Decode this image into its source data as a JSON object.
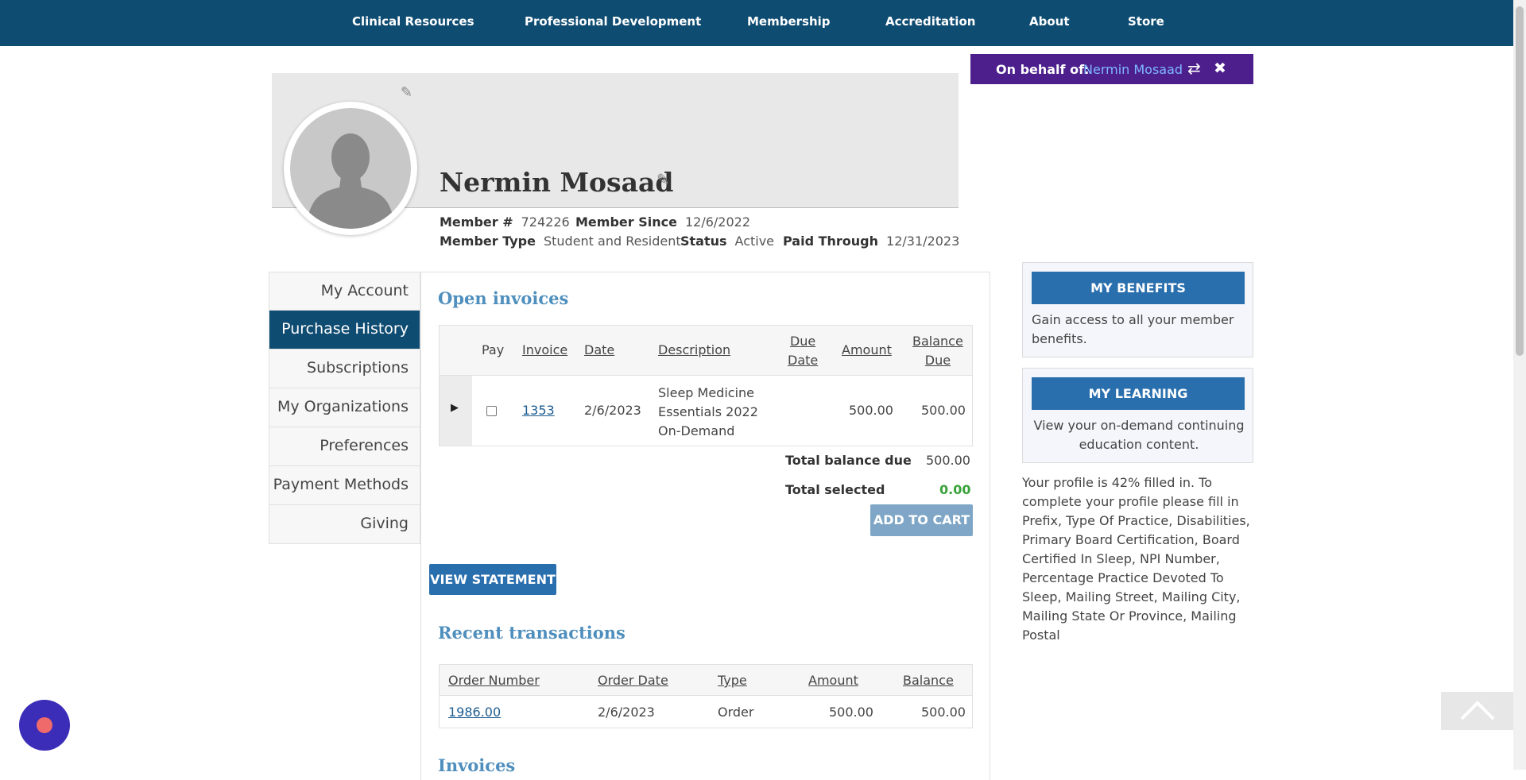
{
  "nav": {
    "items": [
      "Clinical Resources",
      "Professional Development",
      "Membership",
      "Accreditation",
      "About",
      "Store"
    ]
  },
  "behalf": {
    "label": "On behalf of:",
    "name": "Nermin Mosaad",
    "swap_icon": "⇄",
    "close_icon": "✖"
  },
  "profile": {
    "name": "Nermin Mosaad",
    "member_number_label": "Member #",
    "member_number": "724226",
    "member_since_label": "Member Since",
    "member_since": "12/6/2022",
    "member_type_label": "Member Type",
    "member_type": "Student and Resident",
    "status_label": "Status",
    "status": "Active",
    "paid_through_label": "Paid Through",
    "paid_through": "12/31/2023"
  },
  "sidebar": {
    "items": [
      {
        "label": "My Account"
      },
      {
        "label": "Purchase History"
      },
      {
        "label": "Subscriptions"
      },
      {
        "label": "My Organizations"
      },
      {
        "label": "Preferences"
      },
      {
        "label": "Payment Methods"
      },
      {
        "label": "Giving"
      }
    ]
  },
  "open_invoices": {
    "title": "Open invoices",
    "columns": {
      "pay": "Pay",
      "invoice": "Invoice",
      "date": "Date",
      "description": "Description",
      "due_date_1": "Due",
      "due_date_2": "Date",
      "amount": "Amount",
      "balance_due_1": "Balance",
      "balance_due_2": "Due"
    },
    "rows": [
      {
        "invoice": "1353",
        "date": "2/6/2023",
        "description_1": "Sleep Medicine",
        "description_2": "Essentials 2022",
        "description_3": "On-Demand",
        "due_date": "",
        "amount": "500.00",
        "balance_due": "500.00"
      }
    ],
    "total_balance_label": "Total balance due",
    "total_balance": "500.00",
    "total_selected_label": "Total selected",
    "total_selected": "0.00",
    "add_to_cart": "ADD TO CART",
    "view_statement": "VIEW STATEMENT"
  },
  "recent_transactions": {
    "title": "Recent transactions",
    "columns": {
      "order_number": "Order Number",
      "order_date": "Order Date",
      "type": "Type",
      "amount": "Amount",
      "balance": "Balance"
    },
    "rows": [
      {
        "order_number": "1986.00",
        "order_date": "2/6/2023",
        "type": "Order",
        "amount": "500.00",
        "balance": "500.00"
      }
    ]
  },
  "invoices_heading": "Invoices",
  "cards": {
    "benefits": {
      "button": "MY BENEFITS",
      "text": "Gain access to all your member benefits."
    },
    "learning": {
      "button": "MY LEARNING",
      "text": "View your on-demand continuing education content."
    }
  },
  "profile_note": "Your profile is 42% filled in. To complete your profile please fill in Prefix, Type Of Practice, Disabilities, Primary Board Certification, Board Certified In Sleep, NPI Number, Percentage Practice Devoted To Sleep, Mailing Street, Mailing City, Mailing State Or Province, Mailing Postal",
  "colors": {
    "nav_bg": "#0f4c72",
    "behalf_bg": "#4c1f8c",
    "accent_link": "#4f8fbd",
    "button_blue": "#2a6fad",
    "total_selected_green": "#3aa23a"
  }
}
